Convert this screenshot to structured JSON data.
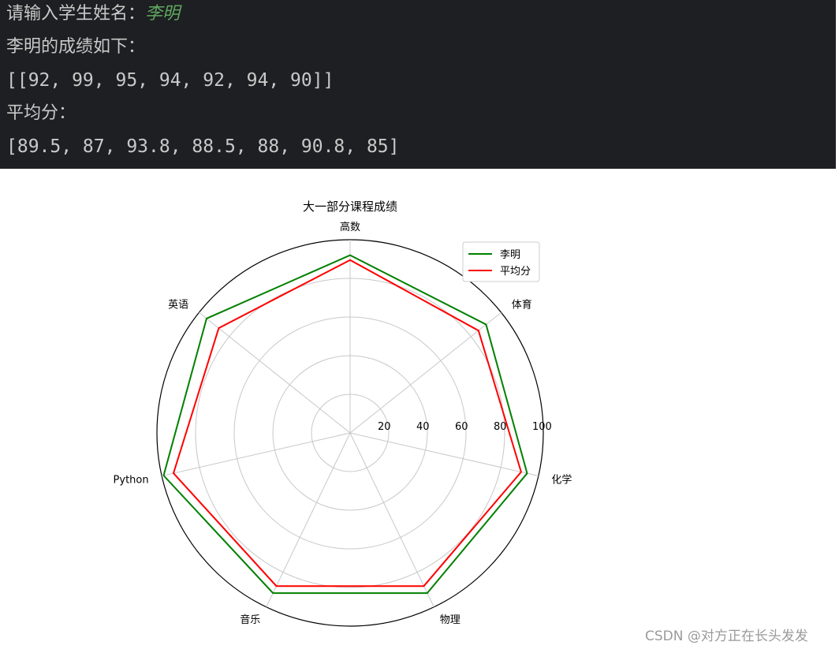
{
  "terminal": {
    "prompt_label": "请输入学生姓名：",
    "prompt_input": "李明",
    "scores_header": "李明的成绩如下：",
    "scores_value": "[[92, 99, 95, 94, 92, 94, 90]]",
    "avg_header": "平均分：",
    "avg_value": "[89.5, 87, 93.8, 88.5, 88, 90.8, 85]"
  },
  "chart_data": {
    "type": "radar",
    "title": "大一部分课程成绩",
    "categories": [
      "高数",
      "体育",
      "化学",
      "物理",
      "音乐",
      "Python",
      "英语"
    ],
    "rlim": [
      0,
      100
    ],
    "rticks": [
      20,
      40,
      60,
      80,
      100
    ],
    "grid": true,
    "legend_position": "top-right",
    "series": [
      {
        "name": "李明",
        "color": "#008000",
        "values": [
          92,
          90,
          94,
          92,
          92,
          99,
          95
        ]
      },
      {
        "name": "平均分",
        "color": "#ff0000",
        "values": [
          89.5,
          85,
          90.8,
          88,
          88,
          93.8,
          87
        ]
      }
    ]
  },
  "watermark": "CSDN @对方正在长头发发"
}
